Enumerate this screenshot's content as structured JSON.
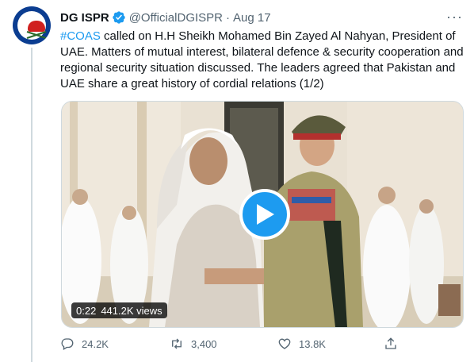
{
  "tweet": {
    "author_name": "DG ISPR",
    "handle": "@OfficialDGISPR",
    "date": "Aug 17",
    "hashtag": "#COAS",
    "text_rest": " called on H.H Sheikh Mohamed Bin Zayed Al Nahyan, President of UAE. Matters of mutual interest, bilateral defence  & security cooperation and regional security situation discussed. The leaders agreed that Pakistan and UAE share a great history of cordial relations (1/2)"
  },
  "video": {
    "duration": "0:22",
    "views": "441.2K views"
  },
  "actions": {
    "replies": "24.2K",
    "retweets": "3,400",
    "likes": "13.8K"
  },
  "icons": [
    "verified-badge-icon",
    "more-icon",
    "play-icon",
    "reply-icon",
    "retweet-icon",
    "like-icon",
    "share-icon"
  ],
  "colors": {
    "accent": "#1d9bf0",
    "text": "#0f1419",
    "muted": "#536471"
  }
}
